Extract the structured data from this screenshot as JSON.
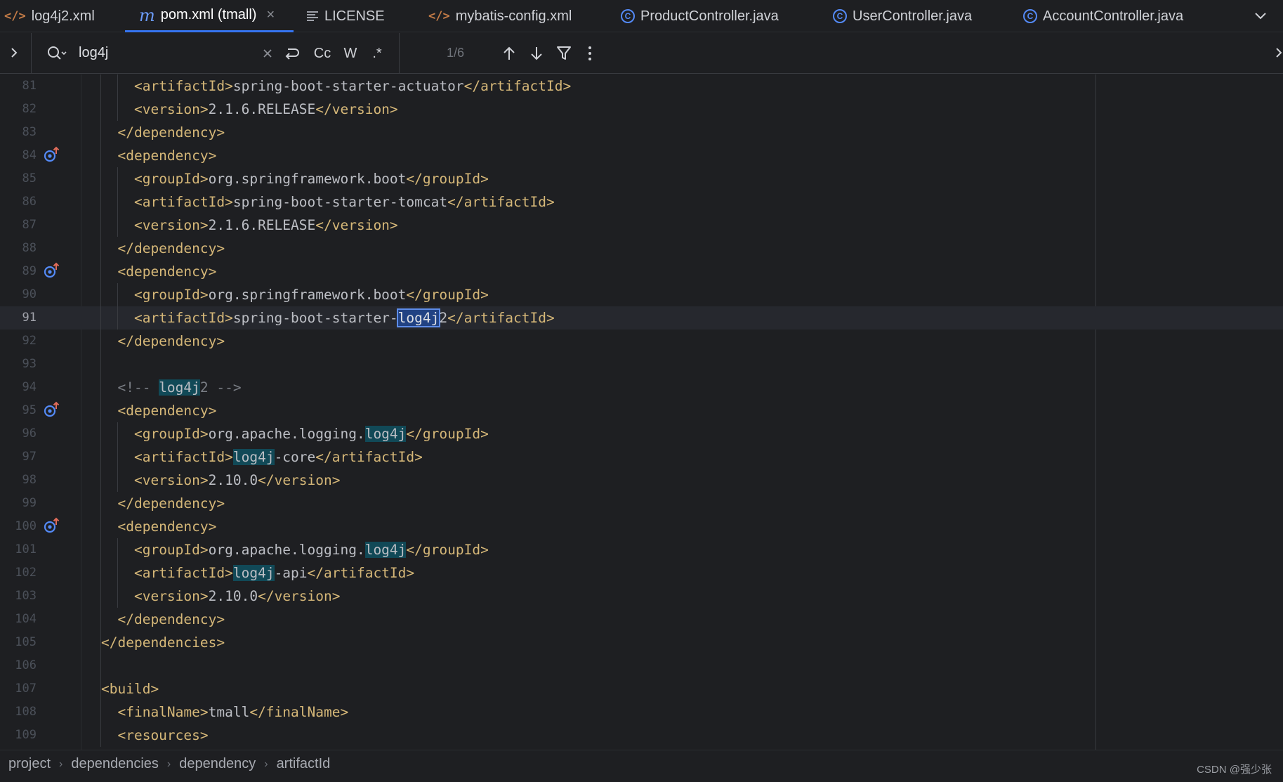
{
  "tabs": [
    {
      "label": "log4j2.xml",
      "icon": "xml-file-icon",
      "active": false
    },
    {
      "label": "pom.xml (tmall)",
      "icon": "maven-file-icon",
      "active": true
    },
    {
      "label": "LICENSE",
      "icon": "text-file-icon",
      "active": false
    },
    {
      "label": "mybatis-config.xml",
      "icon": "xml-file-icon",
      "active": false
    },
    {
      "label": "ProductController.java",
      "icon": "java-class-icon",
      "active": false
    },
    {
      "label": "UserController.java",
      "icon": "java-class-icon",
      "active": false
    },
    {
      "label": "AccountController.java",
      "icon": "java-class-icon",
      "active": false
    }
  ],
  "find": {
    "query": "log4j",
    "match_case_label": "Cc",
    "whole_words_label": "W",
    "regex_label": ".*",
    "match_count": "1/6"
  },
  "editor": {
    "current_line": "91",
    "lines": [
      {
        "n": "81",
        "code": "    <artifactId>spring-boot-starter-actuator</artifactId>"
      },
      {
        "n": "82",
        "code": "    <version>2.1.6.RELEASE</version>"
      },
      {
        "n": "83",
        "code": "  </dependency>"
      },
      {
        "n": "84",
        "code": "  <dependency>",
        "gutter": "override-icon"
      },
      {
        "n": "85",
        "code": "    <groupId>org.springframework.boot</groupId>"
      },
      {
        "n": "86",
        "code": "    <artifactId>spring-boot-starter-tomcat</artifactId>"
      },
      {
        "n": "87",
        "code": "    <version>2.1.6.RELEASE</version>"
      },
      {
        "n": "88",
        "code": "  </dependency>"
      },
      {
        "n": "89",
        "code": "  <dependency>",
        "gutter": "override-icon"
      },
      {
        "n": "90",
        "code": "    <groupId>org.springframework.boot</groupId>"
      },
      {
        "n": "91",
        "code": "    <artifactId>spring-boot-starter-log4j2</artifactId>"
      },
      {
        "n": "92",
        "code": "  </dependency>"
      },
      {
        "n": "93",
        "code": ""
      },
      {
        "n": "94",
        "code": "  <!-- log4j2 -->"
      },
      {
        "n": "95",
        "code": "  <dependency>",
        "gutter": "override-icon"
      },
      {
        "n": "96",
        "code": "    <groupId>org.apache.logging.log4j</groupId>"
      },
      {
        "n": "97",
        "code": "    <artifactId>log4j-core</artifactId>"
      },
      {
        "n": "98",
        "code": "    <version>2.10.0</version>"
      },
      {
        "n": "99",
        "code": "  </dependency>"
      },
      {
        "n": "100",
        "code": "  <dependency>",
        "gutter": "override-icon"
      },
      {
        "n": "101",
        "code": "    <groupId>org.apache.logging.log4j</groupId>"
      },
      {
        "n": "102",
        "code": "    <artifactId>log4j-api</artifactId>"
      },
      {
        "n": "103",
        "code": "    <version>2.10.0</version>"
      },
      {
        "n": "104",
        "code": "  </dependency>"
      },
      {
        "n": "105",
        "code": "</dependencies>"
      },
      {
        "n": "106",
        "code": ""
      },
      {
        "n": "107",
        "code": "<build>"
      },
      {
        "n": "108",
        "code": "  <finalName>tmall</finalName>"
      },
      {
        "n": "109",
        "code": "  <resources>"
      }
    ]
  },
  "breadcrumbs": [
    "project",
    "dependencies",
    "dependency",
    "artifactId"
  ],
  "watermark": "CSDN @强少张",
  "colors": {
    "background": "#1e1f22",
    "tag": "#d5b778",
    "text": "#bcbec4",
    "comment": "#7a7e85",
    "search_match": "#114957",
    "current_match": "#214283",
    "accent": "#3574f0"
  }
}
